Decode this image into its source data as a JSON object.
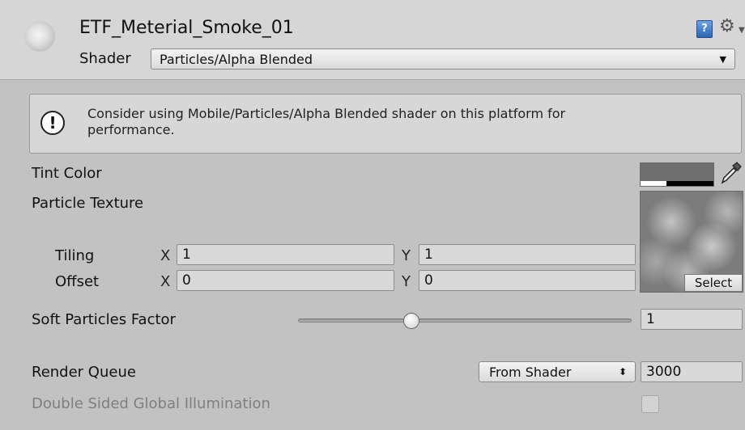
{
  "header": {
    "title": "ETF_Meterial_Smoke_01",
    "shader_label": "Shader",
    "shader_value": "Particles/Alpha Blended",
    "help_icon_text": "?"
  },
  "info_box": {
    "line1": "Consider using Mobile/Particles/Alpha Blended shader on this platform for",
    "line2": "performance."
  },
  "properties": {
    "tint_color": {
      "label": "Tint Color",
      "color": "#6f6f6f",
      "alpha_white_fraction": 0.35
    },
    "particle_texture": {
      "label": "Particle Texture",
      "select_label": "Select",
      "tiling": {
        "label": "Tiling",
        "x_label": "X",
        "x": "1",
        "y_label": "Y",
        "y": "1"
      },
      "offset": {
        "label": "Offset",
        "x_label": "X",
        "x": "0",
        "y_label": "Y",
        "y": "0"
      }
    },
    "soft_particles_factor": {
      "label": "Soft Particles Factor",
      "value": "1",
      "slider_fraction": 0.34
    },
    "render_queue": {
      "label": "Render Queue",
      "mode": "From Shader",
      "value": "3000"
    },
    "double_sided_gi": {
      "label": "Double Sided Global Illumination",
      "checked": false
    }
  }
}
